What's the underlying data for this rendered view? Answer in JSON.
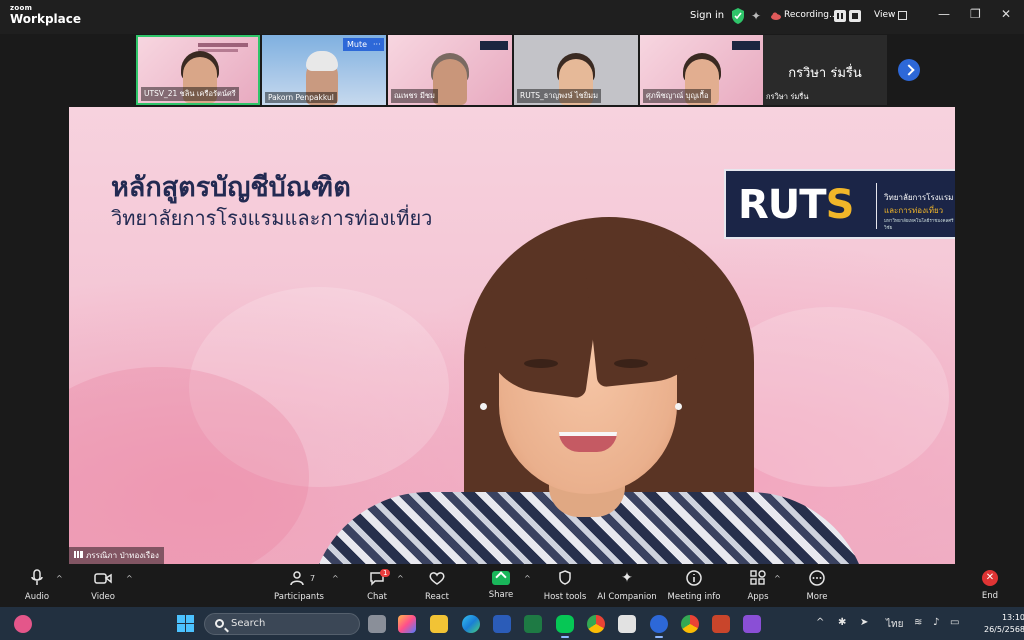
{
  "titlebar": {
    "brand_top": "zoom",
    "brand_bottom": "Workplace",
    "sign_in": "Sign in",
    "recording": "Recording...",
    "view": "View",
    "minimize": "—",
    "restore": "❐",
    "close": "✕"
  },
  "thumbnails": [
    {
      "label": "UTSV_21 ชลิน เครือรัตน์ศรี"
    },
    {
      "label": "Pakorn Penpakkul"
    },
    {
      "label": "ณเพชร มีชม"
    },
    {
      "label": "RUTS_ธาญพงษ์ ไชยิมม"
    },
    {
      "label": "ศุภพิชญาณ์ บุญเกื้อ"
    }
  ],
  "mute_badge": "Mute",
  "more_badge": "···",
  "name_card": {
    "display": "กรวิษา ร่มรื่น",
    "label": "กรวิษา ร่มรื่น"
  },
  "slide": {
    "title": "หลักสูตรบัญชีบัณฑิต",
    "subtitle": "วิทยาลัยการโรงแรมและการท่องเที่ยว",
    "logo_main": "RUT",
    "logo_s": "S",
    "logo_sub1": "วิทยาลัยการโรงแรม",
    "logo_sub2": "และการท่องเที่ยว",
    "logo_sub3": "มหาวิทยาลัยเทคโนโลยีราชมงคลศรีวิชัย"
  },
  "speaker_label": "ภรรณิภา ป่าทองเรือง",
  "toolbar": {
    "audio": "Audio",
    "video": "Video",
    "participants": "Participants",
    "participant_count": "7",
    "chat": "Chat",
    "chat_badge": "1",
    "react": "React",
    "share": "Share",
    "host_tools": "Host tools",
    "ai_companion": "AI Companion",
    "meeting_info": "Meeting info",
    "apps": "Apps",
    "more": "More",
    "end": "End"
  },
  "taskbar": {
    "search": "Search",
    "lang": "ไทย",
    "time": "13:10",
    "date": "26/5/2568"
  },
  "colors": {
    "brand_blue": "#2d68d8",
    "active_green": "#2fc56a",
    "end_red": "#e03434",
    "logo_navy": "#1b2547",
    "logo_gold": "#f1b629"
  }
}
